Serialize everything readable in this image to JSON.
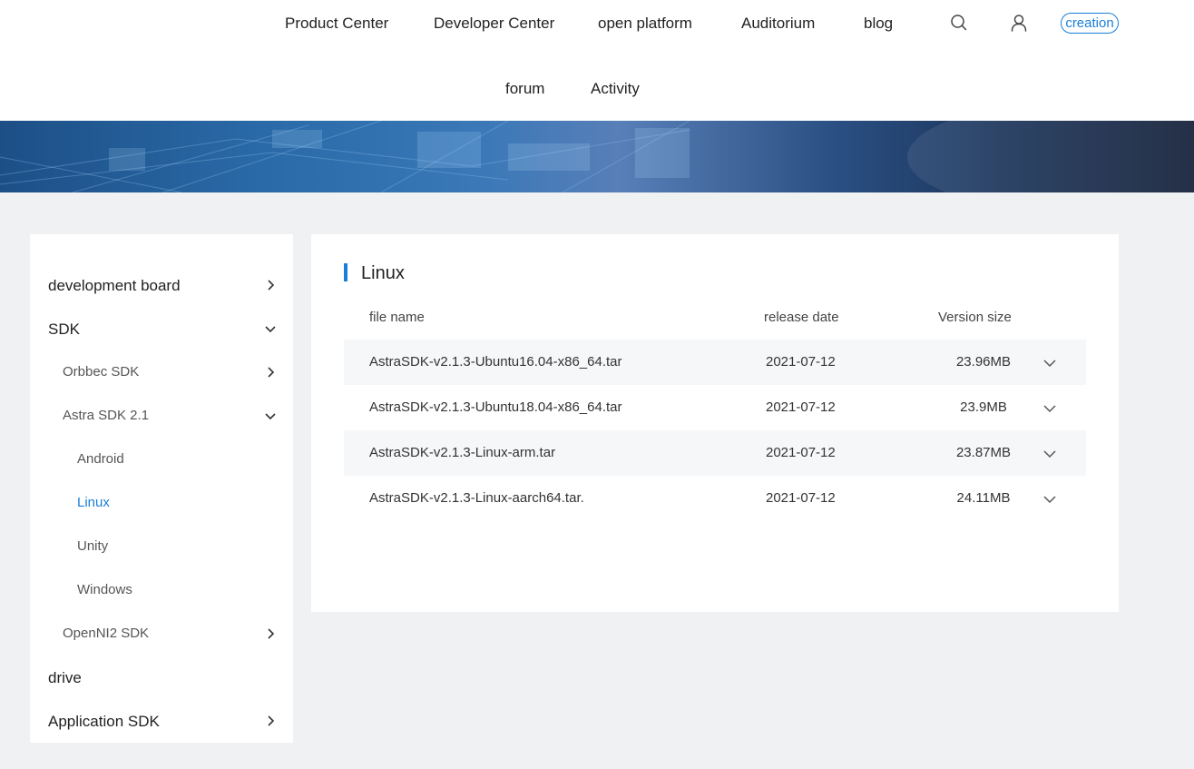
{
  "header": {
    "nav": [
      "Product Center",
      "Developer Center",
      "open platform",
      "Auditorium",
      "blog",
      "forum",
      "Activity"
    ],
    "creation_label": "creation"
  },
  "sidebar": {
    "items": [
      {
        "label": "development board",
        "level": 1,
        "chevron": "right"
      },
      {
        "label": "SDK",
        "level": 1,
        "chevron": "down"
      },
      {
        "label": "Orbbec SDK",
        "level": 2,
        "chevron": "right"
      },
      {
        "label": "Astra SDK 2.1",
        "level": 2,
        "chevron": "down"
      },
      {
        "label": "Android",
        "level": 3,
        "chevron": "none"
      },
      {
        "label": "Linux",
        "level": 3,
        "chevron": "none",
        "active": true
      },
      {
        "label": "Unity",
        "level": 3,
        "chevron": "none"
      },
      {
        "label": "Windows",
        "level": 3,
        "chevron": "none"
      },
      {
        "label": "OpenNI2 SDK",
        "level": 2,
        "chevron": "right"
      },
      {
        "label": "drive",
        "level": 1,
        "chevron": "none"
      },
      {
        "label": "Application SDK",
        "level": 1,
        "chevron": "right"
      }
    ]
  },
  "panel": {
    "title": "Linux",
    "columns": {
      "name": "file name",
      "date": "release date",
      "size": "Version size"
    },
    "rows": [
      {
        "name": "AstraSDK-v2.1.3-Ubuntu16.04-x86_64.tar",
        "date": "2021-07-12",
        "size": "23.96MB"
      },
      {
        "name": "AstraSDK-v2.1.3-Ubuntu18.04-x86_64.tar",
        "date": "2021-07-12",
        "size": "23.9MB"
      },
      {
        "name": "AstraSDK-v2.1.3-Linux-arm.tar",
        "date": "2021-07-12",
        "size": "23.87MB"
      },
      {
        "name": "AstraSDK-v2.1.3-Linux-aarch64.tar.",
        "date": "2021-07-12",
        "size": "24.11MB"
      }
    ]
  },
  "colors": {
    "accent": "#1a7fd9",
    "background": "#f0f1f3",
    "stripe": "#f6f7f9"
  }
}
